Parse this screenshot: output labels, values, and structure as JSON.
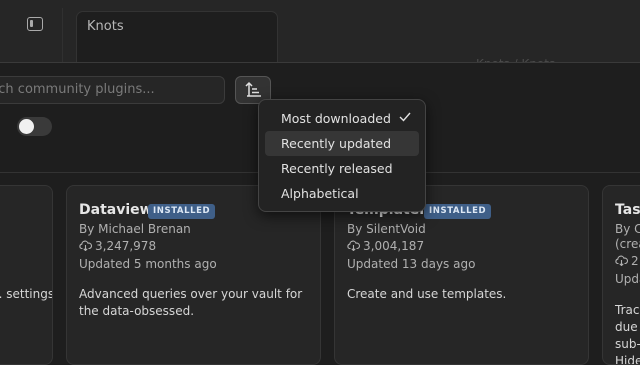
{
  "tab": {
    "title": "Knots"
  },
  "header": {
    "ghost_breadcrumb": "Knots / Knots"
  },
  "search": {
    "placeholder": "Search community plugins..."
  },
  "sort_menu": {
    "items": [
      {
        "label": "Most downloaded",
        "selected": true
      },
      {
        "label": "Recently updated",
        "selected": false
      },
      {
        "label": "Recently released",
        "selected": false
      },
      {
        "label": "Alphabetical",
        "selected": false
      }
    ]
  },
  "cards": [
    {
      "title": "",
      "description": "... settings."
    },
    {
      "title": "Dataview",
      "badge": "INSTALLED",
      "author": "By Michael Brenan",
      "downloads": "3,247,978",
      "updated": "Updated 5 months ago",
      "description_line1": "Advanced queries over your vault for",
      "description_line2": "the data-obsessed."
    },
    {
      "title": "Templater",
      "badge": "INSTALLED",
      "author": "By SilentVoid",
      "downloads": "3,004,187",
      "updated": "Updated 13 days ago",
      "description_line1": "Create and use templates."
    },
    {
      "title": "Tasks",
      "author": "By Cl...",
      "author2": "(crea...",
      "downloads": "2",
      "updated": "Upda...",
      "description_line1": "Trac...",
      "description_line2": "due",
      "description_line3": "sub-",
      "description_line4": "Hide..."
    }
  ],
  "colors": {
    "badge": "#3f5f88",
    "background": "#1e1e1e",
    "card": "#262626"
  }
}
